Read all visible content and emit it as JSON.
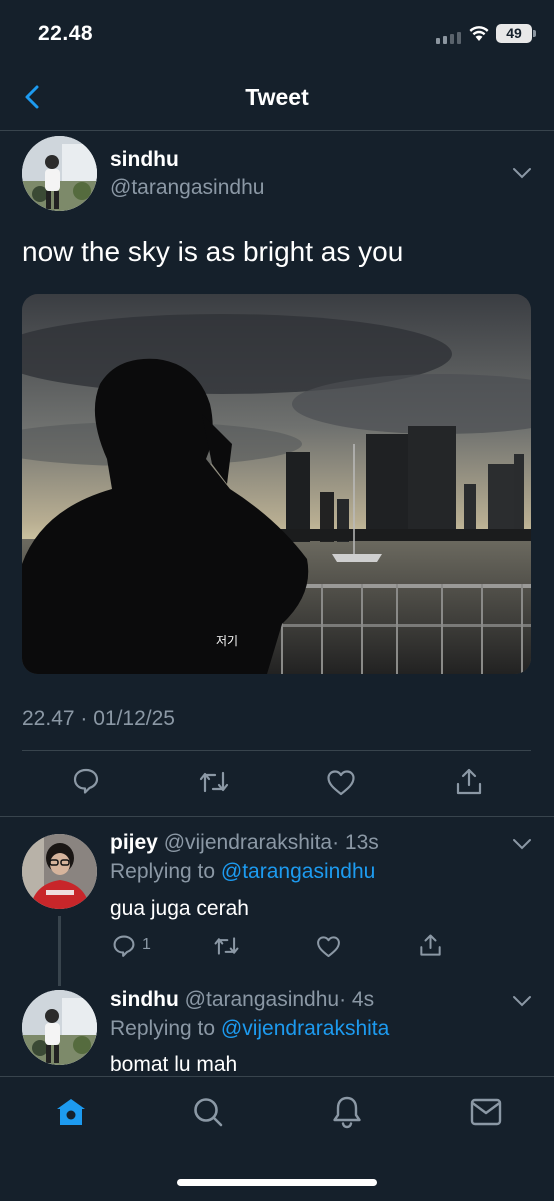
{
  "status_bar": {
    "time": "22.48",
    "battery": "49"
  },
  "header": {
    "title": "Tweet"
  },
  "tweet": {
    "name": "sindhu",
    "handle": "@tarangasindhu",
    "text": "now the sky is as bright as you",
    "media_caption": "저기",
    "timestamp": "22.47 · 01/12/25"
  },
  "replies": [
    {
      "name": "pijey",
      "handle": "@vijendrarakshita",
      "time": "· 13s",
      "replying_label": "Replying to",
      "replying_to": "@tarangasindhu",
      "text": "gua juga cerah",
      "reply_count": "1"
    },
    {
      "name": "sindhu",
      "handle": "@tarangasindhu",
      "time": "· 4s",
      "replying_label": "Replying to",
      "replying_to": "@vijendrarakshita",
      "text": "bomat lu mah"
    }
  ],
  "icons": {
    "back": "chevron-left-icon",
    "reply": "comment-icon",
    "retweet": "retweet-icon",
    "like": "heart-icon",
    "share": "share-icon",
    "home": "home-icon",
    "search": "search-icon",
    "notifications": "bell-icon",
    "messages": "mail-icon"
  },
  "colors": {
    "background": "#15202b",
    "accent": "#1d9bf0",
    "muted": "#8b98a5",
    "divider": "#38444d"
  }
}
